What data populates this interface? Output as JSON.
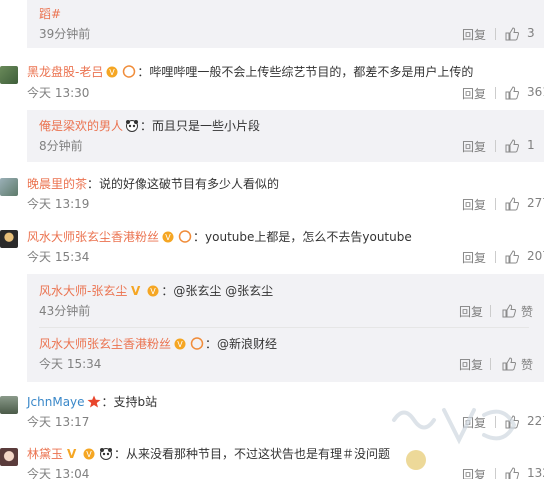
{
  "comments": [
    {
      "partial_text": "蹈#",
      "time": "39分钟前",
      "reply": "回复",
      "likes": "3"
    },
    {
      "user": "黑龙盘股-老吕",
      "text": "：哔哩哔哩一般不会上传些综艺节目的，都差不多是用户上传的",
      "time": "今天 13:30",
      "reply": "回复",
      "likes": "361"
    },
    {
      "user": "俺是梁欢的男人",
      "text": "：而且只是一些小片段",
      "time": "8分钟前",
      "reply": "回复",
      "likes": "1"
    },
    {
      "user": "晚晨里的茶",
      "text": "：说的好像这破节目有多少人看似的",
      "time": "今天 13:19",
      "reply": "回复",
      "likes": "277"
    },
    {
      "user": "风水大师张玄尘香港粉丝",
      "text": "：youtube上都是，怎么不去告youtube",
      "time": "今天 15:34",
      "reply": "回复",
      "likes": "207"
    },
    {
      "user": "风水大师-张玄尘",
      "text": "：@张玄尘 @张玄尘",
      "time": "43分钟前",
      "reply": "回复",
      "likes": "赞"
    },
    {
      "user": "风水大师张玄尘香港粉丝",
      "text": "：@新浪财经",
      "time": "今天 15:34",
      "reply": "回复",
      "likes": "赞"
    },
    {
      "user": "JchnMaye",
      "text": "：支持b站",
      "time": "今天 13:17",
      "reply": "回复",
      "likes": "227"
    },
    {
      "user": "林黛玉",
      "text": "：从来没看那种节目，不过这状告也是有理＃没问题",
      "time": "今天 13:04",
      "reply": "回复",
      "likes": "132"
    }
  ]
}
